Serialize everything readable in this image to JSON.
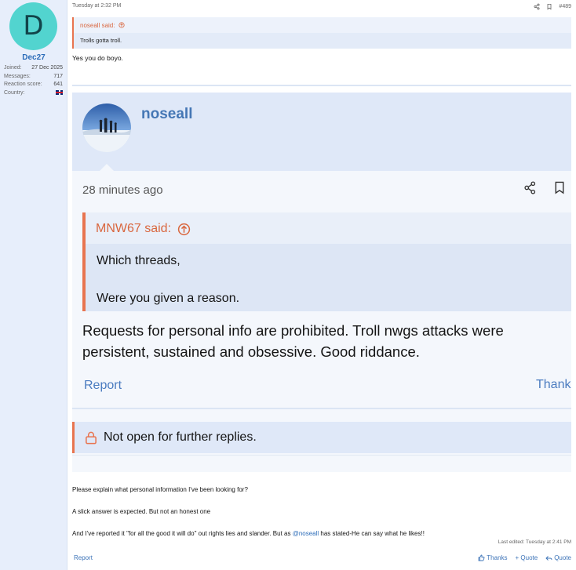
{
  "sidebar": {
    "avatar_letter": "D",
    "username": "Dec27",
    "stats": [
      {
        "label": "Joined:",
        "value": "27 Dec 2025"
      },
      {
        "label": "Messages:",
        "value": "717"
      },
      {
        "label": "Reaction score:",
        "value": "641"
      },
      {
        "label": "Country:",
        "value": ""
      }
    ],
    "avatar_color": "#52d4cf"
  },
  "post": {
    "timestamp": "Tuesday at 2:32 PM",
    "post_number": "#489",
    "quote": {
      "author_label": "noseall said:",
      "text": "Trolls gotta troll."
    },
    "reply": "Yes you do boyo."
  },
  "embed": {
    "author": "noseall",
    "time": "28 minutes ago",
    "quote": {
      "author_label": "MNW67 said:",
      "line1": "Which threads,",
      "line2": "Were you given a reason."
    },
    "text": "Requests for personal info are prohibited. Troll nwgs attacks were persistent, sustained and obsessive. Good riddance.",
    "report_label": "Report",
    "thanks_label": "Thanks",
    "locked_text": "Not open for further replies."
  },
  "body": {
    "line1": "Please explain what personal information I've been looking for?",
    "line2": "A slick answer is expected. But not an honest one",
    "line3_before": "And I've reported it \"for all the good it will do\" out rights lies and slander. But as ",
    "line3_mention": "@noseall",
    "line3_after": " has stated-He can say what he likes!!",
    "last_edited": "Last edited: Tuesday at 2:41 PM"
  },
  "footer": {
    "report": "Report",
    "thanks": "Thanks",
    "add_quote": "+ Quote",
    "quote": "Quote"
  },
  "colors": {
    "accent_orange": "#e8744f",
    "link_blue": "#2a6bb8",
    "panel_blue": "#dfe8f8"
  }
}
